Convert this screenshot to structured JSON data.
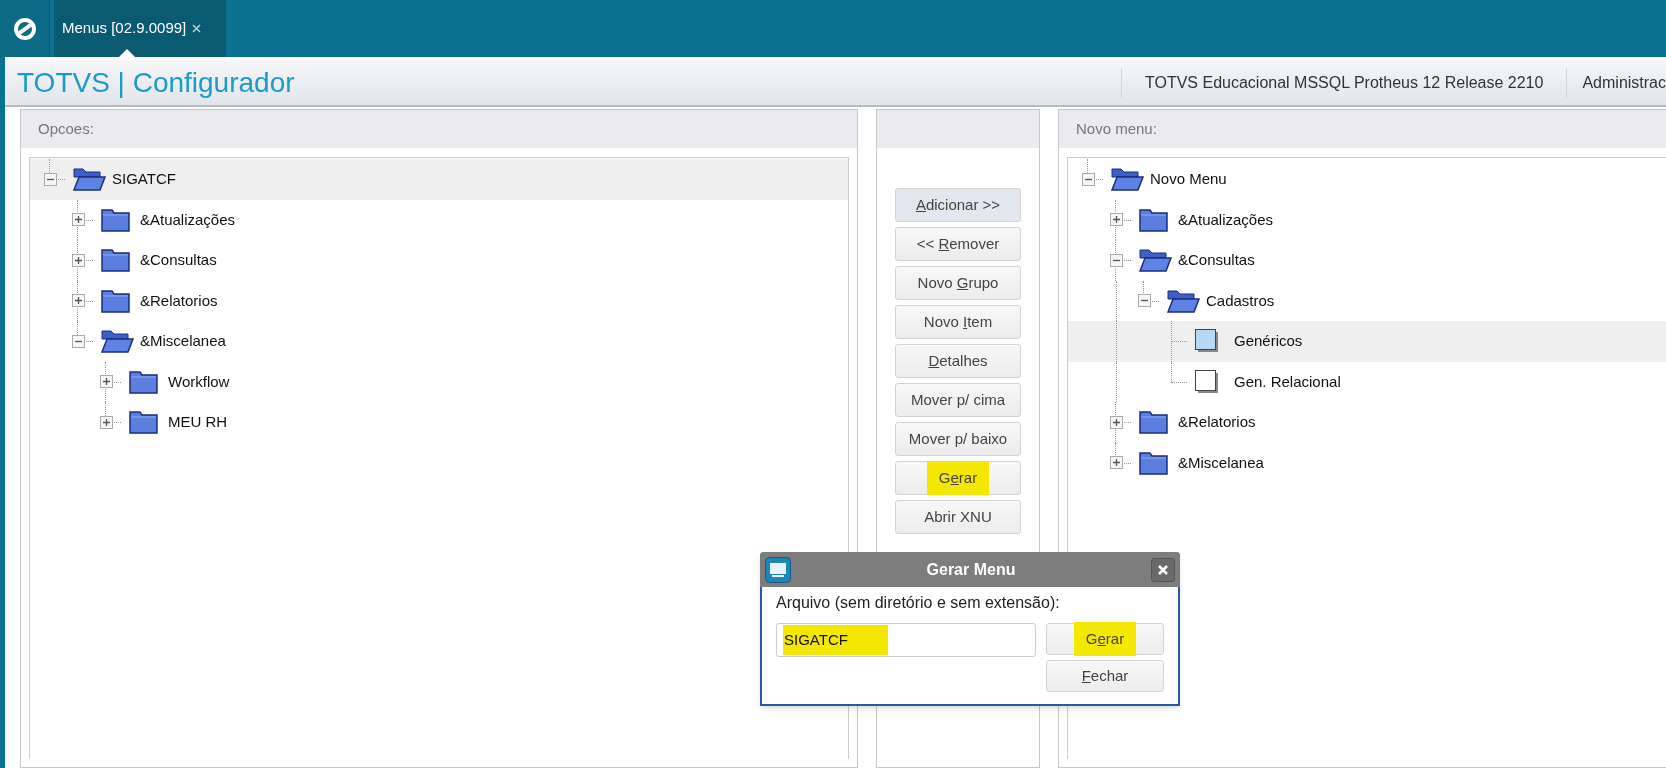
{
  "tab_bar": {
    "tabs": [
      {
        "label": "Menus [02.9.0099]",
        "selected": true
      }
    ]
  },
  "header": {
    "title": "TOTVS | Configurador",
    "environment": "TOTVS Educacional MSSQL Protheus 12 Release 2210",
    "user": "Administrac"
  },
  "options_panel": {
    "title": "Opcoes:",
    "tree": [
      {
        "label": "SIGATCF",
        "kind": "folder",
        "expanded": true,
        "selected": true,
        "children": [
          {
            "label": "&Atualizações",
            "kind": "folder",
            "expanded": false,
            "selected": false
          },
          {
            "label": "&Consultas",
            "kind": "folder",
            "expanded": false,
            "selected": false
          },
          {
            "label": "&Relatorios",
            "kind": "folder",
            "expanded": false,
            "selected": false
          },
          {
            "label": "&Miscelanea",
            "kind": "folder",
            "expanded": true,
            "selected": false,
            "children": [
              {
                "label": "Workflow",
                "kind": "folder",
                "expanded": false,
                "selected": false
              },
              {
                "label": "MEU RH",
                "kind": "folder",
                "expanded": false,
                "selected": false
              }
            ]
          }
        ]
      }
    ]
  },
  "actions_panel": {
    "buttons": [
      {
        "key": "A",
        "post": "dicionar >>",
        "focused": true,
        "highlighted": false
      },
      {
        "pre": "<< ",
        "key": "R",
        "post": "emover",
        "focused": false,
        "highlighted": false
      },
      {
        "pre": "Novo ",
        "key": "G",
        "post": "rupo",
        "focused": false,
        "highlighted": false
      },
      {
        "pre": "Novo ",
        "key": "I",
        "post": "tem",
        "focused": false,
        "highlighted": false
      },
      {
        "key": "D",
        "post": "etalhes",
        "focused": false,
        "highlighted": false
      },
      {
        "pre": "Mover p/ cima",
        "focused": false,
        "highlighted": false
      },
      {
        "pre": "Mover p/ baixo",
        "focused": false,
        "highlighted": false
      },
      {
        "pre": "G",
        "key": "e",
        "post": "rar",
        "focused": false,
        "highlighted": true
      },
      {
        "pre": "Abrir XNU",
        "focused": false,
        "highlighted": false
      }
    ]
  },
  "new_menu_panel": {
    "title": "Novo menu:",
    "tree": [
      {
        "label": "Novo Menu",
        "kind": "folder",
        "expanded": true,
        "selected": false,
        "children": [
          {
            "label": "&Atualizações",
            "kind": "folder",
            "expanded": false,
            "selected": false
          },
          {
            "label": "&Consultas",
            "kind": "folder",
            "expanded": true,
            "selected": false,
            "children": [
              {
                "label": "Cadastros",
                "kind": "folder",
                "expanded": true,
                "selected": false,
                "children": [
                  {
                    "label": "Genéricos",
                    "kind": "item",
                    "selected": true
                  },
                  {
                    "label": "Gen. Relacional",
                    "kind": "item",
                    "selected": false
                  }
                ]
              }
            ]
          },
          {
            "label": "&Relatorios",
            "kind": "folder",
            "expanded": false,
            "selected": false
          },
          {
            "label": "&Miscelanea",
            "kind": "folder",
            "expanded": false,
            "selected": false
          }
        ]
      }
    ]
  },
  "dialog": {
    "title": "Gerar Menu",
    "label": "Arquivo (sem diretório e sem extensão):",
    "field": {
      "value": "SIGATCF",
      "highlighted": true
    },
    "buttons": [
      {
        "pre": "G",
        "key": "e",
        "post": "rar",
        "highlighted": true
      },
      {
        "key": "F",
        "post": "echar",
        "highlighted": false
      }
    ]
  }
}
